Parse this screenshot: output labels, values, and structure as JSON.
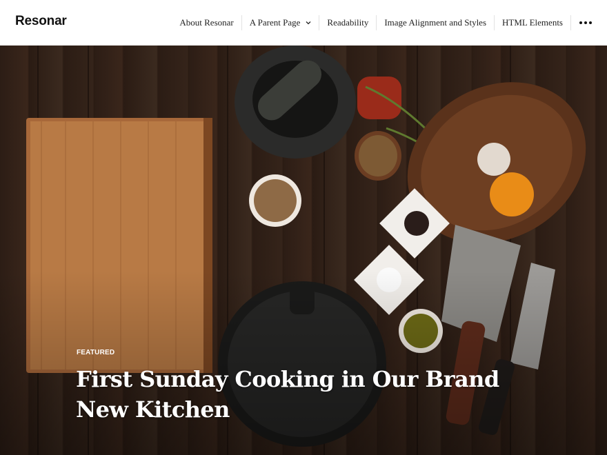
{
  "site": {
    "title": "Resonar"
  },
  "nav": {
    "items": [
      {
        "label": "About Resonar",
        "has_submenu": false
      },
      {
        "label": "A Parent Page",
        "has_submenu": true
      },
      {
        "label": "Readability",
        "has_submenu": false
      },
      {
        "label": "Image Alignment and Styles",
        "has_submenu": false
      },
      {
        "label": "HTML Elements",
        "has_submenu": false
      }
    ],
    "more_icon": "ellipsis-icon",
    "submenu_icon": "chevron-down-icon"
  },
  "hero": {
    "label": "FEATURED",
    "title": "First Sunday Cooking in Our Brand New Kitchen"
  },
  "colors": {
    "header_bg": "#ffffff",
    "text": "#111111",
    "hero_text": "#ffffff",
    "wood_dark": "#2c1d15"
  }
}
